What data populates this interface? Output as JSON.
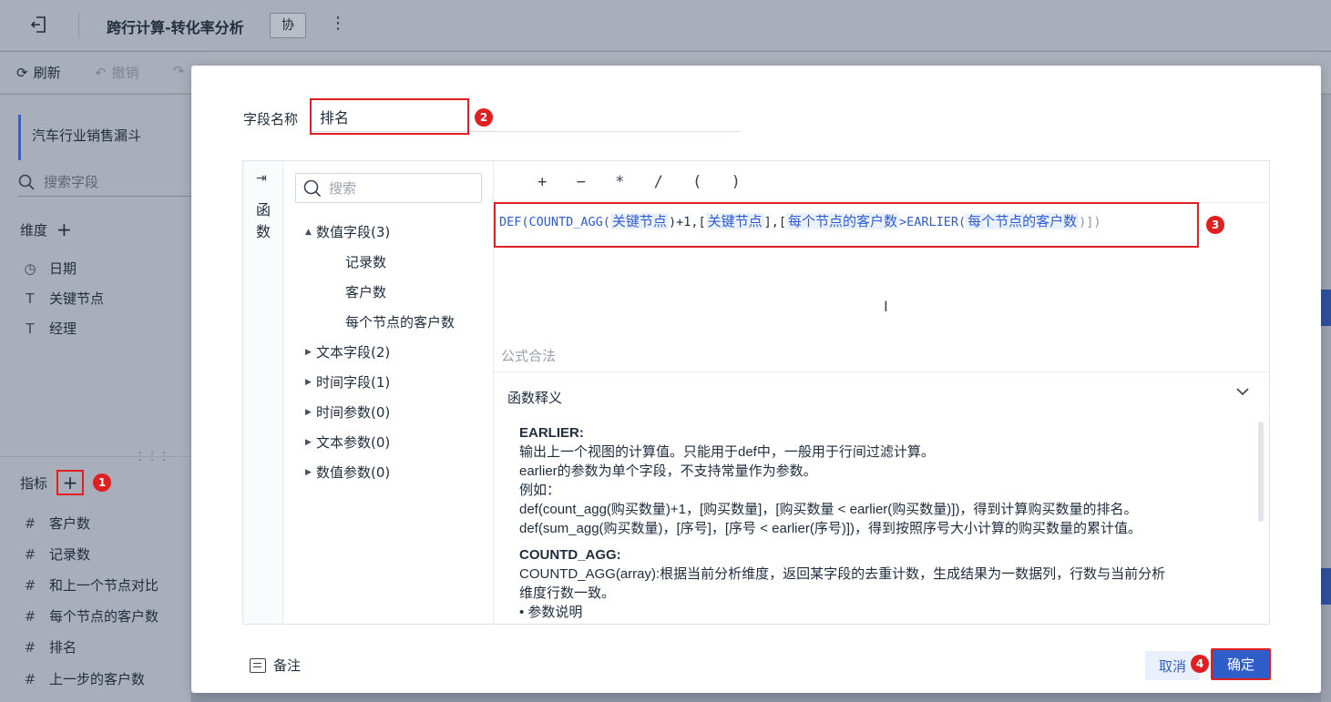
{
  "app": {
    "title": "跨行计算-转化率分析",
    "collab_label": "协",
    "more_icon": "⋮"
  },
  "toolbar": {
    "refresh_label": "刷新",
    "undo_label": "撤销"
  },
  "left": {
    "dataset_name": "汽车行业销售漏斗",
    "search_placeholder": "搜索字段",
    "dimension_header": "维度",
    "dimensions": [
      {
        "label": "日期",
        "icon": "clock-icon"
      },
      {
        "label": "关键节点",
        "icon": "text-type-icon"
      },
      {
        "label": "经理",
        "icon": "text-type-icon"
      }
    ],
    "measure_header": "指标",
    "measures": [
      {
        "label": "客户数",
        "icon": "number-icon"
      },
      {
        "label": "记录数",
        "icon": "number-icon"
      },
      {
        "label": "和上一个节点对比",
        "icon": "calc-number-icon"
      },
      {
        "label": "每个节点的客户数",
        "icon": "calc-number-icon"
      },
      {
        "label": "排名",
        "icon": "calc-number-icon"
      },
      {
        "label": "上一步的客户数",
        "icon": "calc-number-icon"
      }
    ],
    "badge1": "1"
  },
  "dialog": {
    "field_name_label": "字段名称",
    "field_name_value": "排名",
    "badge2": "2",
    "func_rail_label": "函数",
    "field_search_placeholder": "搜索",
    "tree": [
      {
        "label": "数值字段(3)",
        "expanded": true,
        "children": [
          "记录数",
          "客户数",
          "每个节点的客户数"
        ]
      },
      {
        "label": "文本字段(2)",
        "expanded": false
      },
      {
        "label": "时间字段(1)",
        "expanded": false
      },
      {
        "label": "时间参数(0)",
        "expanded": false
      },
      {
        "label": "文本参数(0)",
        "expanded": false
      },
      {
        "label": "数值参数(0)",
        "expanded": false
      }
    ],
    "operators": [
      "+",
      "−",
      "*",
      "/",
      "(",
      ")"
    ],
    "formula": {
      "p1": "DEF(COUNTD_AGG(",
      "f1": "关键节点",
      "p2": ")+1,[",
      "f2": "关键节点",
      "p3": "],[",
      "f3": "每个节点的客户数",
      "p4": ">EARLIER(",
      "f4": "每个节点的客户数",
      "p5": ")])"
    },
    "badge3": "3",
    "validity_text": "公式合法",
    "explain_title": "函数释义",
    "explain_lines": {
      "h1": "EARLIER:",
      "l1": "输出上一个视图的计算值。只能用于def中，一般用于行间过滤计算。",
      "l2": "earlier的参数为单个字段，不支持常量作为参数。",
      "l3": "例如：",
      "l4": "def(count_agg(购买数量)+1，[购买数量]，[购买数量 < earlier(购买数量)])，得到计算购买数量的排名。",
      "l5": "def(sum_agg(购买数量)，[序号]，[序号 < earlier(序号)])，得到按照序号大小计算的购买数量的累计值。",
      "h2": "COUNTD_AGG:",
      "l6": "COUNTD_AGG(array):根据当前分析维度，返回某字段的去重计数，生成结果为一数据列，行数与当前分析",
      "l7": "维度行数一致。",
      "l8": "• 参数说明"
    },
    "note_label": "备注",
    "cancel_label": "取消",
    "badge4": "4",
    "ok_label": "确定"
  }
}
